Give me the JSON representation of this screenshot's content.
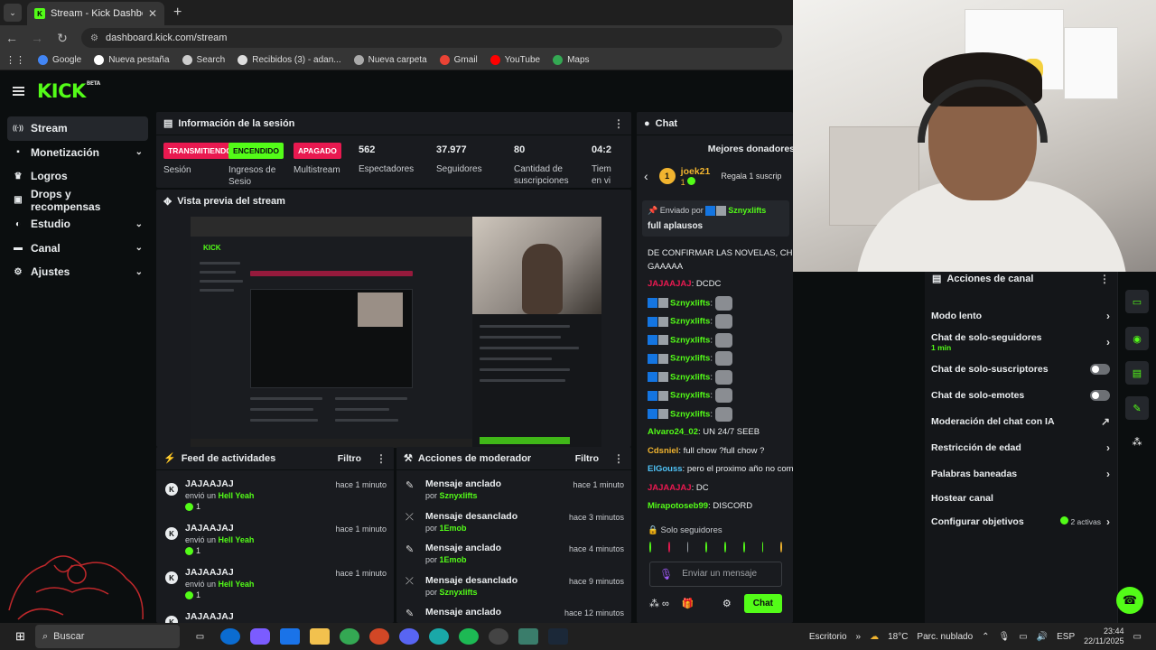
{
  "browser": {
    "tab_title": "Stream - Kick Dashboard",
    "url": "dashboard.kick.com/stream",
    "bookmarks": [
      {
        "label": "Google",
        "color": "#4285f4"
      },
      {
        "label": "Nueva pestaña",
        "color": "#ffffff"
      },
      {
        "label": "Search",
        "color": "#cccccc"
      },
      {
        "label": "Recibidos (3) - adan...",
        "color": "#dddddd"
      },
      {
        "label": "Nueva carpeta",
        "color": "#aaaaaa"
      },
      {
        "label": "Gmail",
        "color": "#ea4335"
      },
      {
        "label": "YouTube",
        "color": "#ff0000"
      },
      {
        "label": "Maps",
        "color": "#34a853"
      }
    ]
  },
  "app": {
    "logo": "KICK",
    "logo_tag": "BETA",
    "accent": "#53fc18"
  },
  "sidebar": {
    "items": [
      {
        "label": "Stream",
        "icon": "stream-icon",
        "active": true
      },
      {
        "label": "Monetización",
        "icon": "money-icon"
      },
      {
        "label": "Logros",
        "icon": "trophy-icon"
      },
      {
        "label": "Drops y recompensas",
        "icon": "gift-icon"
      },
      {
        "label": "Estudio",
        "icon": "studio-icon"
      },
      {
        "label": "Canal",
        "icon": "channel-icon"
      },
      {
        "label": "Ajustes",
        "icon": "gear-icon"
      }
    ]
  },
  "session": {
    "title": "Información de la sesión",
    "stats": [
      {
        "badge": "TRANSMITIENDO",
        "label": "Sesión"
      },
      {
        "badge": "ENCENDIDO",
        "label": "Ingresos de Sesio"
      },
      {
        "badge": "APAGADO",
        "label": "Multistream"
      },
      {
        "value": "562",
        "label": "Espectadores"
      },
      {
        "value": "37.977",
        "label": "Seguidores"
      },
      {
        "value": "80",
        "label": "Cantidad de suscripciones"
      },
      {
        "value": "04:2",
        "label": "Tiem en vi"
      }
    ]
  },
  "preview": {
    "title": "Vista previa del stream"
  },
  "feed": {
    "title": "Feed de actividades",
    "filter": "Filtro",
    "rows": [
      {
        "name": "JAJAAJAJ",
        "action": "envió un",
        "item": "Hell Yeah",
        "count": "1",
        "time": "hace 1 minuto"
      },
      {
        "name": "JAJAAJAJ",
        "action": "envió un",
        "item": "Hell Yeah",
        "count": "1",
        "time": "hace 1 minuto"
      },
      {
        "name": "JAJAAJAJ",
        "action": "envió un",
        "item": "Hell Yeah",
        "count": "1",
        "time": "hace 1 minuto"
      },
      {
        "name": "JAJAAJAJ",
        "action": "",
        "item": "",
        "count": "",
        "time": ""
      }
    ]
  },
  "mod": {
    "title": "Acciones de moderador",
    "filter": "Filtro",
    "rows": [
      {
        "title": "Mensaje anclado",
        "by": "por",
        "user": "Sznyxlifts",
        "time": "hace 1 minuto",
        "icon": "pin-icon"
      },
      {
        "title": "Mensaje desanclado",
        "by": "por",
        "user": "1Emob",
        "time": "hace 3 minutos",
        "icon": "unpin-icon"
      },
      {
        "title": "Mensaje anclado",
        "by": "por",
        "user": "1Emob",
        "time": "hace 4 minutos",
        "icon": "pin-icon"
      },
      {
        "title": "Mensaje desanclado",
        "by": "por",
        "user": "Sznyxlifts",
        "time": "hace 9 minutos",
        "icon": "unpin-icon"
      },
      {
        "title": "Mensaje anclado",
        "by": "",
        "user": "",
        "time": "hace 12 minutos",
        "icon": "pin-icon"
      }
    ]
  },
  "chat": {
    "title": "Chat",
    "donors_title": "Mejores donadores",
    "donor": {
      "rank": "1",
      "name": "joek21",
      "amount": "1",
      "note": "Regala 1 suscrip"
    },
    "pinned": {
      "label": "Enviado por",
      "user": "Sznyxlifts",
      "message": "full aplausos"
    },
    "messages": [
      {
        "user": "",
        "text": "DE CONFIRMAR LAS NOVELAS, CHEVE",
        "color": "#e9ecee"
      },
      {
        "user": "",
        "text": "GAAAAA",
        "color": "#e9ecee"
      },
      {
        "user": "JAJAAJAJ",
        "text": "DCDC",
        "color": "#e91950"
      },
      {
        "user": "Sznyxlifts",
        "text": "",
        "color": "#53fc18",
        "emote": true
      },
      {
        "user": "Sznyxlifts",
        "text": "",
        "color": "#53fc18",
        "emote": true
      },
      {
        "user": "Sznyxlifts",
        "text": "",
        "color": "#53fc18",
        "emote": true
      },
      {
        "user": "Sznyxlifts",
        "text": "",
        "color": "#53fc18",
        "emote": true
      },
      {
        "user": "Sznyxlifts",
        "text": "",
        "color": "#53fc18",
        "emote": true
      },
      {
        "user": "Sznyxlifts",
        "text": "",
        "color": "#53fc18",
        "emote": true
      },
      {
        "user": "Sznyxlifts",
        "text": "",
        "color": "#53fc18",
        "emote": true
      },
      {
        "user": "Alvaro24_02",
        "text": "UN 24/7 SEEB",
        "color": "#53fc18"
      },
      {
        "user": "Cdsniel",
        "text": "full chow ?full chow ?",
        "color": "#f1b42f"
      },
      {
        "user": "ElGouss",
        "text": "pero el proximo año no compites?",
        "color": "#4fc3f7"
      },
      {
        "user": "JAJAAJAJ",
        "text": "DC",
        "color": "#e91950"
      },
      {
        "user": "Mirapotoseb99",
        "text": "DISCORD",
        "color": "#53fc18"
      }
    ],
    "followers_only": "Solo seguidores",
    "input_placeholder": "Enviar un mensaje",
    "send_label": "Chat"
  },
  "channel_actions": {
    "title": "Acciones de canal",
    "items": [
      {
        "label": "Modo lento",
        "control": "chevron"
      },
      {
        "label": "Chat de solo-seguidores",
        "sub": "1 min",
        "control": "chevron"
      },
      {
        "label": "Chat de solo-suscriptores",
        "control": "toggle"
      },
      {
        "label": "Chat de solo-emotes",
        "control": "toggle"
      },
      {
        "label": "Moderación del chat con IA",
        "control": "external"
      },
      {
        "label": "Restricción de edad",
        "control": "chevron"
      },
      {
        "label": "Palabras baneadas",
        "control": "chevron"
      },
      {
        "label": "Hostear canal",
        "control": "none"
      },
      {
        "label": "Configurar objetivos",
        "status": "2 activas",
        "control": "chevron"
      }
    ]
  },
  "taskbar": {
    "search": "Buscar",
    "desktop": "Escritorio",
    "temp": "18°C",
    "weather": "Parc. nublado",
    "lang": "ESP",
    "time": "23:44",
    "date": "22/11/2025"
  }
}
